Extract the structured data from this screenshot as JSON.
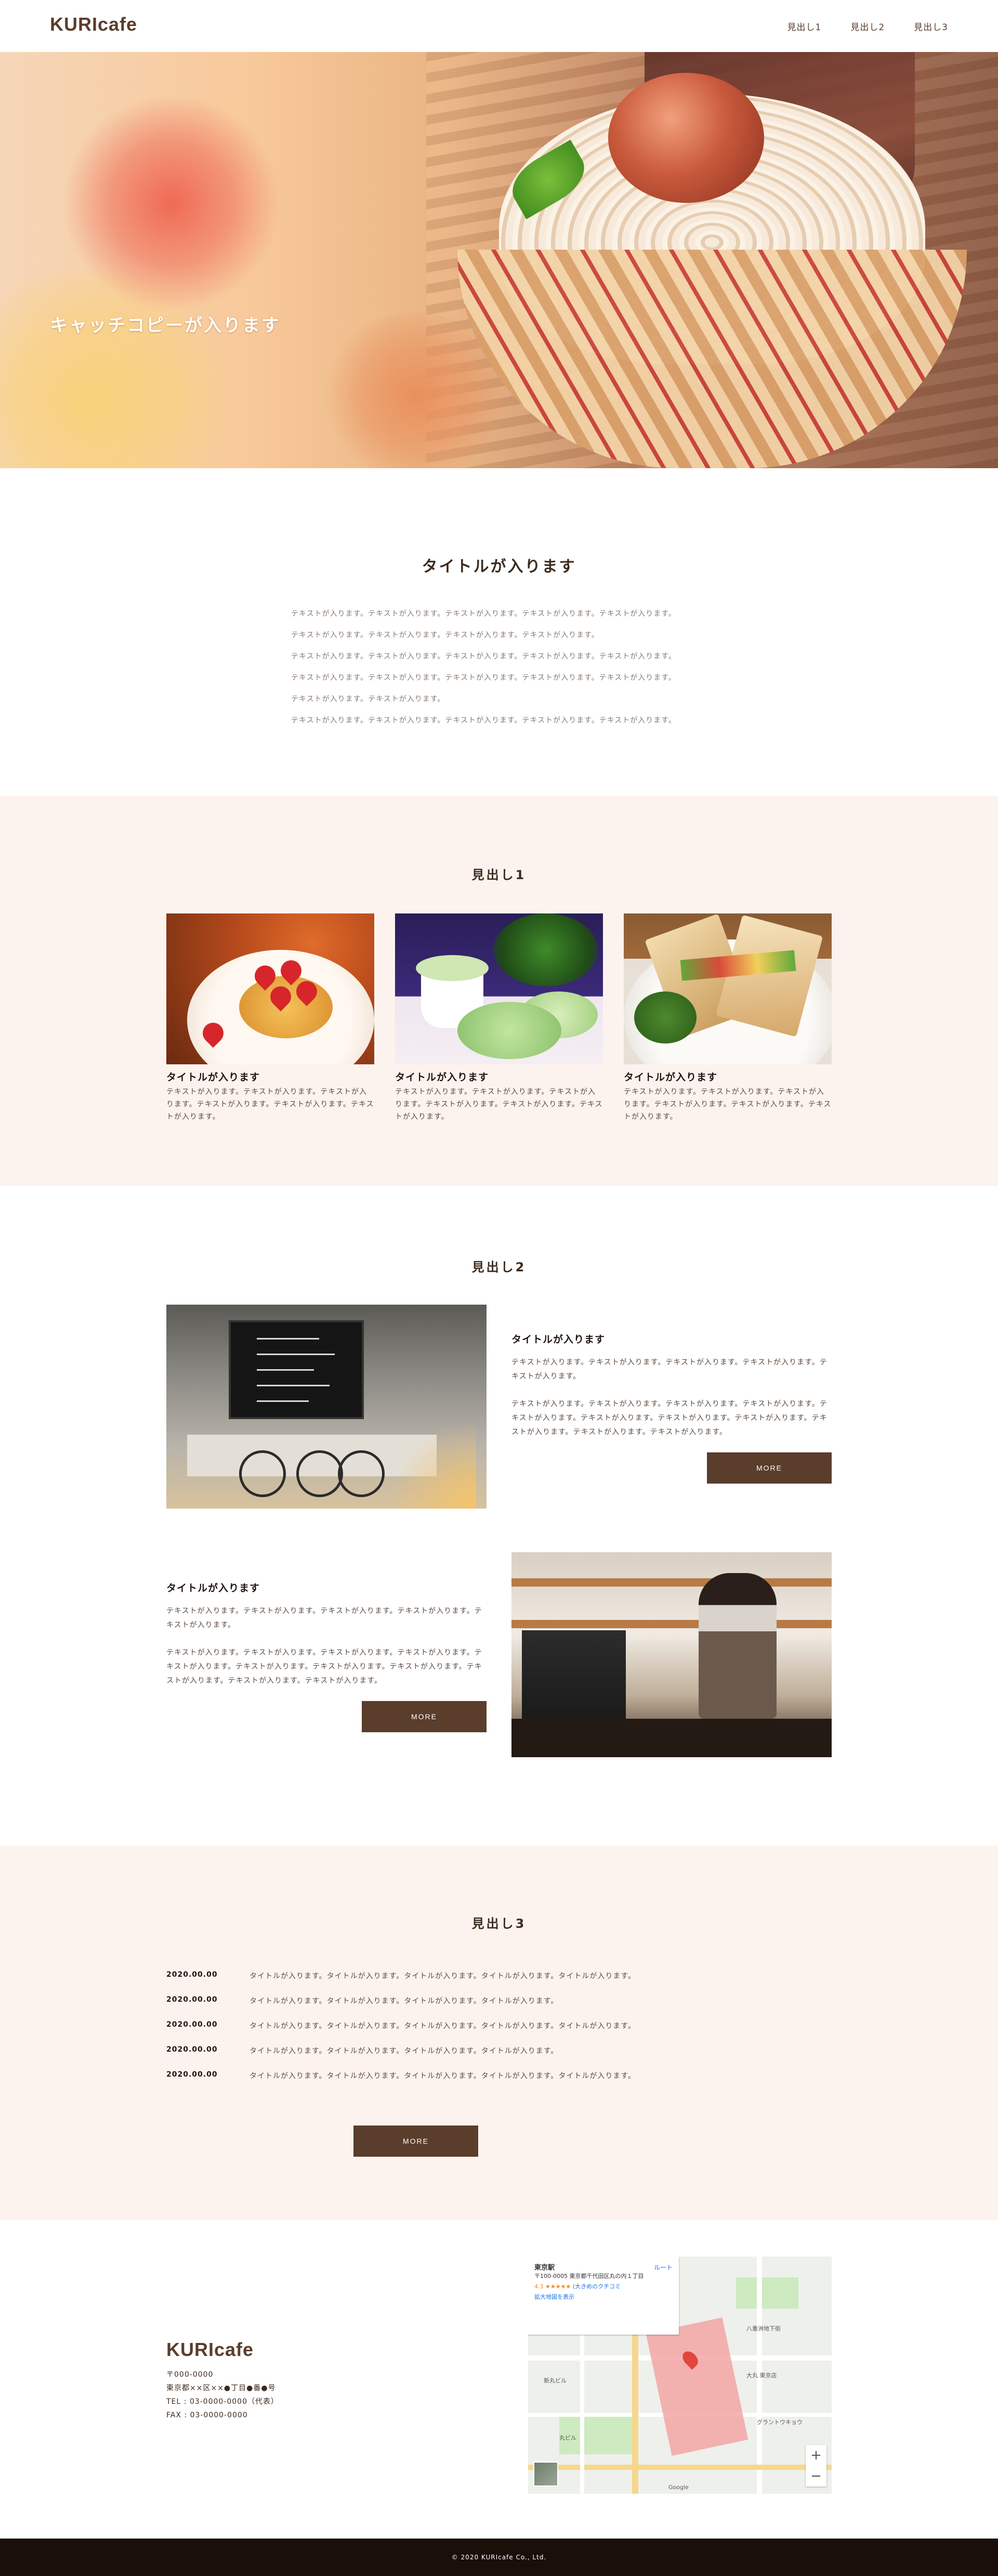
{
  "header": {
    "logo": "KURIcafe",
    "nav": [
      "見出し1",
      "見出し2",
      "見出し3"
    ]
  },
  "hero": {
    "catch_copy": "キャッチコピーが入ります"
  },
  "intro": {
    "title": "タイトルが入ります",
    "lines": [
      "テキストが入ります。テキストが入ります。テキストが入ります。テキストが入ります。テキストが入ります。",
      "テキストが入ります。テキストが入ります。テキストが入ります。テキストが入ります。",
      "テキストが入ります。テキストが入ります。テキストが入ります。テキストが入ります。テキストが入ります。",
      "テキストが入ります。テキストが入ります。テキストが入ります。テキストが入ります。テキストが入ります。",
      "テキストが入ります。テキストが入ります。",
      "テキストが入ります。テキストが入ります。テキストが入ります。テキストが入ります。テキストが入ります。"
    ]
  },
  "section1": {
    "heading": "見出し1",
    "cards": [
      {
        "title": "タイトルが入ります",
        "text": "テキストが入ります。テキストが入ります。テキストが入ります。テキストが入ります。テキストが入ります。テキストが入ります。"
      },
      {
        "title": "タイトルが入ります",
        "text": "テキストが入ります。テキストが入ります。テキストが入ります。テキストが入ります。テキストが入ります。テキストが入ります。"
      },
      {
        "title": "タイトルが入ります",
        "text": "テキストが入ります。テキストが入ります。テキストが入ります。テキストが入ります。テキストが入ります。テキストが入ります。"
      }
    ]
  },
  "section2": {
    "heading": "見出し2",
    "features": [
      {
        "title": "タイトルが入ります",
        "p1": "テキストが入ります。テキストが入ります。テキストが入ります。テキストが入ります。テキストが入ります。",
        "p2": "テキストが入ります。テキストが入ります。テキストが入ります。テキストが入ります。テキストが入ります。テキストが入ります。テキストが入ります。テキストが入ります。テキストが入ります。テキストが入ります。テキストが入ります。",
        "button": "MORE"
      },
      {
        "title": "タイトルが入ります",
        "p1": "テキストが入ります。テキストが入ります。テキストが入ります。テキストが入ります。テキストが入ります。",
        "p2": "テキストが入ります。テキストが入ります。テキストが入ります。テキストが入ります。テキストが入ります。テキストが入ります。テキストが入ります。テキストが入ります。テキストが入ります。テキストが入ります。テキストが入ります。",
        "button": "MORE"
      }
    ]
  },
  "section3": {
    "heading": "見出し3",
    "news": [
      {
        "date": "2020.00.00",
        "text": "タイトルが入ります。タイトルが入ります。タイトルが入ります。タイトルが入ります。タイトルが入ります。"
      },
      {
        "date": "2020.00.00",
        "text": "タイトルが入ります。タイトルが入ります。タイトルが入ります。タイトルが入ります。"
      },
      {
        "date": "2020.00.00",
        "text": "タイトルが入ります。タイトルが入ります。タイトルが入ります。タイトルが入ります。タイトルが入ります。"
      },
      {
        "date": "2020.00.00",
        "text": "タイトルが入ります。タイトルが入ります。タイトルが入ります。タイトルが入ります。"
      },
      {
        "date": "2020.00.00",
        "text": "タイトルが入ります。タイトルが入ります。タイトルが入ります。タイトルが入ります。タイトルが入ります。"
      }
    ],
    "button": "MORE"
  },
  "footer": {
    "logo": "KURIcafe",
    "address_lines": [
      "〒000-0000",
      "東京都××区××●丁目●番●号",
      "TEL : 03-0000-0000（代表）",
      "FAX : 03-0000-0000"
    ],
    "copyright": "© 2020 KURIcafe Co., Ltd."
  },
  "map": {
    "place_name": "東京駅",
    "address": "〒100-0005 東京都千代田区丸の内１丁目",
    "rating": "4.3 ★★★★★",
    "reviews": "(大きめのクチコミ",
    "enlarge_link": "拡大地図を表示",
    "directions": "ルート",
    "labels": [
      "八重洲地下街",
      "大丸 東京店",
      "新丸ビル",
      "丸ビル",
      "グラントウキョウ",
      "Google"
    ]
  },
  "colors": {
    "brand_brown": "#5a3d2b",
    "section_bg": "#fcf3ee",
    "footer_bar": "#1b0f0a"
  }
}
